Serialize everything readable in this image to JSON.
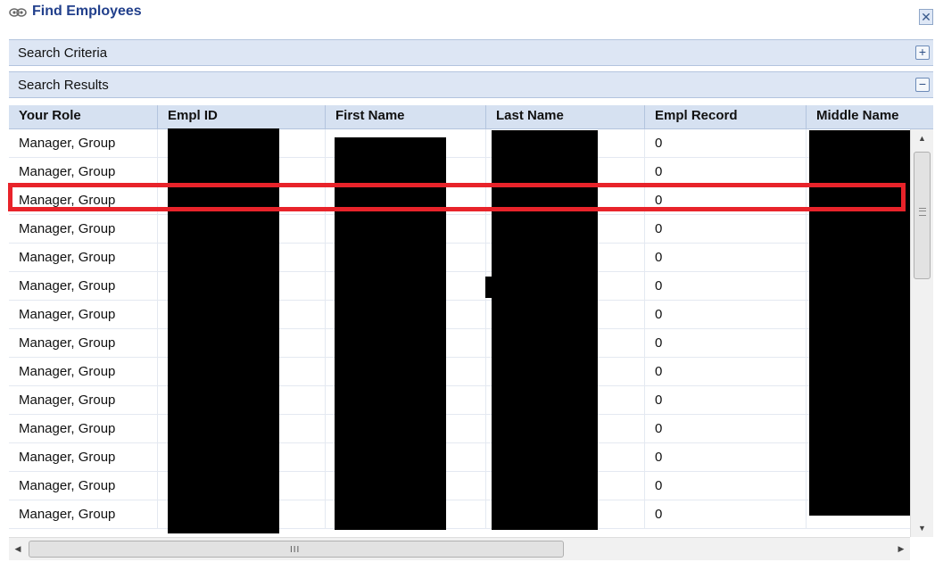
{
  "window": {
    "title": "Find Employees",
    "eye_icon": "eye-icon",
    "close_glyph": "✕"
  },
  "sections": {
    "criteria": {
      "label": "Search Criteria",
      "toggle": "+"
    },
    "results": {
      "label": "Search Results",
      "toggle": "−"
    }
  },
  "grid": {
    "columns": [
      "Your Role",
      "Empl ID",
      "First Name",
      "Last Name",
      "Empl Record",
      "Middle Name"
    ],
    "rows": [
      {
        "role": "Manager, Group",
        "record": "0"
      },
      {
        "role": "Manager, Group",
        "record": "0"
      },
      {
        "role": "Manager, Group",
        "record": "0"
      },
      {
        "role": "Manager, Group",
        "record": "0"
      },
      {
        "role": "Manager, Group",
        "record": "0"
      },
      {
        "role": "Manager, Group",
        "record": "0"
      },
      {
        "role": "Manager, Group",
        "record": "0"
      },
      {
        "role": "Manager, Group",
        "record": "0"
      },
      {
        "role": "Manager, Group",
        "record": "0"
      },
      {
        "role": "Manager, Group",
        "record": "0"
      },
      {
        "role": "Manager, Group",
        "record": "0"
      },
      {
        "role": "Manager, Group",
        "record": "0"
      },
      {
        "role": "Manager, Group",
        "record": "0"
      },
      {
        "role": "Manager, Group",
        "record": "0"
      }
    ],
    "highlighted_row": 2,
    "redacted_columns": [
      "Empl ID",
      "First Name",
      "Last Name",
      "Middle Name"
    ]
  },
  "colors": {
    "title": "#22408c",
    "section_bg": "#dde6f4",
    "header_bg": "#d6e1f1",
    "highlight": "#e8232a",
    "redaction": "#000000"
  },
  "scrollbars": {
    "up": "▲",
    "down": "▼",
    "left": "◀",
    "right": "▶",
    "grip": "III"
  }
}
